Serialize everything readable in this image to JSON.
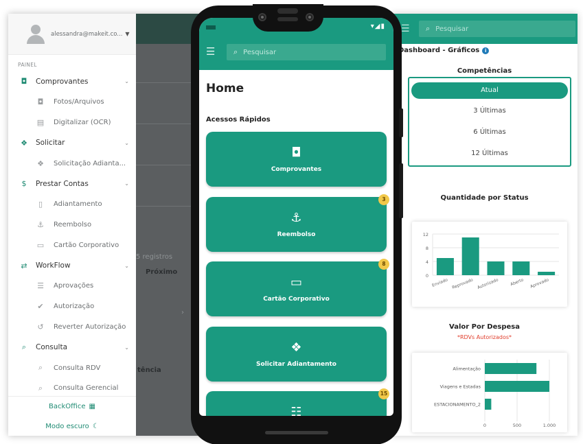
{
  "sidebar": {
    "user_email": "alessandra@makeit.co...",
    "section_label": "PAINEL",
    "items": [
      {
        "label": "Comprovantes",
        "icon": "camera-icon",
        "glyph": "◘",
        "type": "top",
        "chevron": "⌄"
      },
      {
        "label": "Fotos/Arquivos",
        "icon": "camera-icon",
        "glyph": "◘",
        "type": "sub"
      },
      {
        "label": "Digitalizar (OCR)",
        "icon": "scanner-icon",
        "glyph": "▤",
        "type": "sub"
      },
      {
        "label": "Solicitar",
        "icon": "money-chat-icon",
        "glyph": "❖",
        "type": "top",
        "chevron": "⌄"
      },
      {
        "label": "Solicitação Adianta...",
        "icon": "money-chat-icon",
        "glyph": "❖",
        "type": "sub"
      },
      {
        "label": "Prestar Contas",
        "icon": "dollar-icon",
        "glyph": "$",
        "type": "top",
        "chevron": "⌄"
      },
      {
        "label": "Adiantamento",
        "icon": "document-icon",
        "glyph": "▯",
        "type": "sub"
      },
      {
        "label": "Reembolso",
        "icon": "hand-dollar-icon",
        "glyph": "⚓",
        "type": "sub"
      },
      {
        "label": "Cartão Corporativo",
        "icon": "credit-card-icon",
        "glyph": "▭",
        "type": "sub"
      },
      {
        "label": "WorkFlow",
        "icon": "swap-arrows-icon",
        "glyph": "⇄",
        "type": "top",
        "chevron": "⌄"
      },
      {
        "label": "Aprovações",
        "icon": "checklist-icon",
        "glyph": "☰",
        "type": "sub"
      },
      {
        "label": "Autorização",
        "icon": "double-check-icon",
        "glyph": "✔",
        "type": "sub"
      },
      {
        "label": "Reverter Autorização",
        "icon": "undo-clock-icon",
        "glyph": "↺",
        "type": "sub"
      },
      {
        "label": "Consulta",
        "icon": "search-icon",
        "glyph": "⌕",
        "type": "top",
        "chevron": "⌄"
      },
      {
        "label": "Consulta RDV",
        "icon": "search-icon",
        "glyph": "⌕",
        "type": "sub"
      },
      {
        "label": "Consulta Gerencial",
        "icon": "search-icon",
        "glyph": "⌕",
        "type": "sub"
      }
    ],
    "backoffice_label": "BackOffice",
    "dark_mode_label": "Modo escuro"
  },
  "background_table": {
    "records_text": "5 registros",
    "next_label": "Próximo",
    "column_fragment": "tência"
  },
  "phone": {
    "search_placeholder": "Pesquisar",
    "title": "Home",
    "quick_access_title": "Acessos Rápidos",
    "quick_access": [
      {
        "label": "Comprovantes",
        "icon": "camera-icon",
        "glyph": "◘",
        "badge": ""
      },
      {
        "label": "Reembolso",
        "icon": "hand-dollar-icon",
        "glyph": "⚓",
        "badge": "3"
      },
      {
        "label": "Cartão Corporativo",
        "icon": "credit-card-icon",
        "glyph": "▭",
        "badge": "8"
      },
      {
        "label": "Solicitar Adiantamento",
        "icon": "money-chat-icon",
        "glyph": "❖",
        "badge": ""
      },
      {
        "label": "",
        "icon": "calculator-icon",
        "glyph": "☷",
        "badge": "15"
      }
    ]
  },
  "dashboard": {
    "search_placeholder": "Pesquisar",
    "heading": "Dashboard - Gráficos",
    "competencias_title": "Competências",
    "competencias_options": [
      "Atual",
      "3 Últimas",
      "6 Últimas",
      "12 Últimas"
    ],
    "competencias_selected": "Atual",
    "status_chart_title": "Quantidade por Status",
    "despesa_chart_title": "Valor Por Despesa",
    "despesa_chart_note": "*RDVs Autorizados*"
  },
  "colors": {
    "primary": "#1a9a80",
    "badge": "#f1c84a",
    "note_red": "#e03c2a",
    "dark_overlay": "#5b5e60"
  },
  "chart_data": [
    {
      "type": "bar",
      "title": "Quantidade por Status",
      "categories": [
        "Enviado",
        "Reprovado",
        "Autorizado",
        "Aberto",
        "Aprovado"
      ],
      "values": [
        5,
        11,
        4,
        4,
        1
      ],
      "ylim": [
        0,
        12
      ],
      "yticks": [
        0,
        4,
        8,
        12
      ],
      "grid": true
    },
    {
      "type": "bar",
      "orientation": "horizontal",
      "title": "Valor Por Despesa",
      "subtitle": "*RDVs Autorizados*",
      "categories": [
        "Alimentação",
        "Viagens e Estadas",
        "ESTACIONAMENTO_2"
      ],
      "values": [
        800,
        1000,
        100
      ],
      "xlim": [
        0,
        1000
      ],
      "xticks": [
        "0",
        "500",
        "1.000"
      ],
      "grid": true
    }
  ]
}
